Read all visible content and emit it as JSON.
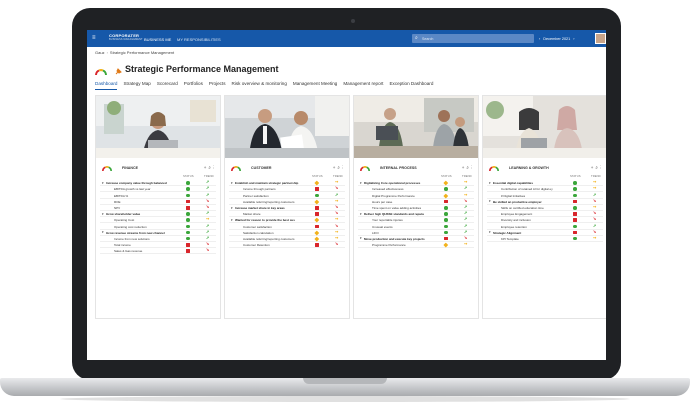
{
  "app": {
    "product": "CORPORATER",
    "product_sub": "BUSINESS MANAGEMENT",
    "nav_primary": "BUSINESS ME",
    "nav_secondary": "MY RESPONSIBILITIES",
    "search_placeholder": "Search",
    "period": "December 2021",
    "period_prev": "‹",
    "period_next": "›",
    "brand_color": "#1658a9"
  },
  "breadcrumb": {
    "home": "Gauz",
    "page": "Strategic Performance Management"
  },
  "page_title": "Strategic Performance Management",
  "tabs": [
    "Dashboard",
    "Strategy Map",
    "Scorecard",
    "Portfolios",
    "Projects",
    "Risk overview & monitoring",
    "Management Meeting",
    "Management report",
    "Exception Dashboard"
  ],
  "active_tab": "Dashboard",
  "columns": {
    "status": "STATUS",
    "trend": "TREND"
  },
  "status_colors": {
    "green": "#3aa63a",
    "yellow": "#f2b21c",
    "red": "#d9262c"
  },
  "perspectives": [
    {
      "title": "FINANCE",
      "rows": [
        {
          "type": "objective",
          "label": "Increase company value through balanced",
          "status": "green",
          "trend": "up-right",
          "trend_color": "green"
        },
        {
          "type": "kpi",
          "label": "EBITDA growth vs last year",
          "status": "green",
          "trend": "up-right",
          "trend_color": "green"
        },
        {
          "type": "kpi",
          "label": "EBITDA %",
          "status": "green",
          "trend": "up-right",
          "trend_color": "green"
        },
        {
          "type": "kpi",
          "label": "ROE",
          "status": "red",
          "trend": "down-right",
          "trend_color": "red"
        },
        {
          "type": "kpi",
          "label": "NPV",
          "status": "red",
          "trend": "down-right",
          "trend_color": "red"
        },
        {
          "type": "objective",
          "label": "Grow shareholder value",
          "status": "green",
          "trend": "up-right",
          "trend_color": "green"
        },
        {
          "type": "kpi",
          "label": "Operating Cost",
          "status": "green",
          "trend": "right",
          "trend_color": "yellow"
        },
        {
          "type": "kpi",
          "label": "Operating cost reduction",
          "status": "green",
          "trend": "up-right",
          "trend_color": "green"
        },
        {
          "type": "objective",
          "label": "Grow revenue streams from new channel",
          "status": "green",
          "trend": "up-right",
          "trend_color": "green"
        },
        {
          "type": "kpi",
          "label": "Income from new solutions",
          "status": "green",
          "trend": "up-right",
          "trend_color": "green"
        },
        {
          "type": "kpi",
          "label": "Total income",
          "status": "red",
          "trend": "down-right",
          "trend_color": "red"
        },
        {
          "type": "kpi",
          "label": "Sales & Gas revenue",
          "status": "red",
          "trend": "down-right",
          "trend_color": "red"
        }
      ]
    },
    {
      "title": "CUSTOMER",
      "rows": [
        {
          "type": "objective",
          "label": "Establish and maintain strategic partnership",
          "status": "yellow",
          "trend": "right",
          "trend_color": "yellow"
        },
        {
          "type": "kpi",
          "label": "Income through partners",
          "status": "red",
          "trend": "down-right",
          "trend_color": "red"
        },
        {
          "type": "kpi",
          "label": "Partner satisfaction",
          "status": "green",
          "trend": "up-right",
          "trend_color": "green"
        },
        {
          "type": "kpi",
          "label": "Available referring/reporting customers",
          "status": "yellow",
          "trend": "right",
          "trend_color": "yellow"
        },
        {
          "type": "objective",
          "label": "Increase market share in key areas",
          "status": "red",
          "trend": "down-right",
          "trend_color": "red"
        },
        {
          "type": "kpi",
          "label": "Market share",
          "status": "red",
          "trend": "down-right",
          "trend_color": "red"
        },
        {
          "type": "objective",
          "label": "Wanted for reason to provide the best sus",
          "status": "yellow",
          "trend": "right",
          "trend_color": "yellow"
        },
        {
          "type": "kpi",
          "label": "Customer satisfaction",
          "status": "red",
          "trend": "down-right",
          "trend_color": "red"
        },
        {
          "type": "kpi",
          "label": "Satisfaction calculation",
          "status": "yellow",
          "trend": "right",
          "trend_color": "yellow"
        },
        {
          "type": "kpi",
          "label": "Available referring/reporting customers",
          "status": "yellow",
          "trend": "right",
          "trend_color": "yellow"
        },
        {
          "type": "kpi",
          "label": "Customer Retention",
          "status": "red",
          "trend": "down-right",
          "trend_color": "red"
        }
      ]
    },
    {
      "title": "INTERNAL PROCESS",
      "rows": [
        {
          "type": "objective",
          "label": "Digitalizing Core operational processes",
          "status": "yellow",
          "trend": "right",
          "trend_color": "yellow"
        },
        {
          "type": "kpi",
          "label": "Increased effectiveness",
          "status": "green",
          "trend": "up-right",
          "trend_color": "green"
        },
        {
          "type": "kpi",
          "label": "Digital Programme Performance",
          "status": "yellow",
          "trend": "right",
          "trend_color": "yellow"
        },
        {
          "type": "kpi",
          "label": "Hours per case",
          "status": "red",
          "trend": "down-right",
          "trend_color": "red"
        },
        {
          "type": "kpi",
          "label": "Time spent on value adding activities",
          "status": "green",
          "trend": "up-right",
          "trend_color": "green"
        },
        {
          "type": "objective",
          "label": "Deliver high QHSSE standards and reputa",
          "status": "green",
          "trend": "up-right",
          "trend_color": "green"
        },
        {
          "type": "kpi",
          "label": "Your reportable injuries",
          "status": "green",
          "trend": "up-right",
          "trend_color": "green"
        },
        {
          "type": "kpi",
          "label": "Unusual events",
          "status": "green",
          "trend": "up-right",
          "trend_color": "green"
        },
        {
          "type": "kpi",
          "label": "LIFO",
          "status": "green",
          "trend": "up-right",
          "trend_color": "green"
        },
        {
          "type": "objective",
          "label": "Move production and execute key projects",
          "status": "red",
          "trend": "down-right",
          "trend_color": "red"
        },
        {
          "type": "kpi",
          "label": "Programme Performance",
          "status": "yellow",
          "trend": "right",
          "trend_color": "yellow"
        }
      ]
    },
    {
      "title": "LEARNING & GROWTH",
      "rows": [
        {
          "type": "objective",
          "label": "Essential digital capabilities",
          "status": "green",
          "trend": "right",
          "trend_color": "yellow"
        },
        {
          "type": "kpi",
          "label": "Contribution of retained AI for digital ey",
          "status": "green",
          "trend": "right",
          "trend_color": "yellow"
        },
        {
          "type": "kpi",
          "label": "# Digital Initiatives",
          "status": "green",
          "trend": "up-right",
          "trend_color": "green"
        },
        {
          "type": "objective",
          "label": "Be skilled an productive employer",
          "status": "red",
          "trend": "down-right",
          "trend_color": "red"
        },
        {
          "type": "kpi",
          "label": "Skills on certified education time",
          "status": "green",
          "trend": "right",
          "trend_color": "yellow"
        },
        {
          "type": "kpi",
          "label": "Employee Engagement",
          "status": "red",
          "trend": "down-right",
          "trend_color": "red"
        },
        {
          "type": "kpi",
          "label": "Diversity and inclusion",
          "status": "red",
          "trend": "down-right",
          "trend_color": "red"
        },
        {
          "type": "kpi",
          "label": "Employee retention",
          "status": "green",
          "trend": "up-right",
          "trend_color": "green"
        },
        {
          "type": "objective",
          "label": "Strategic Alignment",
          "status": "red",
          "trend": "down-right",
          "trend_color": "red"
        },
        {
          "type": "kpi",
          "label": "KPI Template",
          "status": "green",
          "trend": "right",
          "trend_color": "yellow"
        }
      ]
    }
  ]
}
